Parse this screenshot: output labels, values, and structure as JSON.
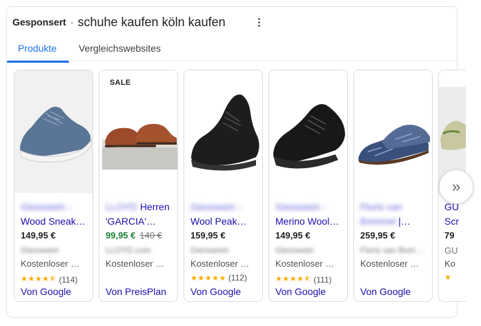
{
  "header": {
    "sponsored": "Gesponsert",
    "separator": "·",
    "query": "schuhe kaufen köln kaufen",
    "more_icon": "more-vert-icon"
  },
  "tabs": [
    {
      "label": "Produkte",
      "active": true
    },
    {
      "label": "Vergleichswebsites",
      "active": false
    }
  ],
  "products": [
    {
      "title": "Giesswein - Wood Sneak…",
      "title_line1": "Giesswein -",
      "title_line2": "Wood Sneak…",
      "price": "149,95 €",
      "merchant": "Giesswein",
      "shipping": "Kostenloser …",
      "rating": 4.5,
      "reviews": "(114)",
      "provider": "Von Google"
    },
    {
      "badge": "SALE",
      "title_line1_blur": "LLOYD",
      "title_line1": "Herren",
      "title_line2": "'GARCIA'…",
      "price": "99,95 €",
      "old_price": "140 €",
      "merchant": "LLOYD.com",
      "shipping": "Kostenloser …",
      "provider": "Von PreisPlan"
    },
    {
      "title_line1": "Giesswein -",
      "title_line2": "Wool Peak…",
      "price": "159,95 €",
      "merchant": "Giesswein",
      "shipping": "Kostenloser …",
      "rating": 5,
      "reviews": "(112)",
      "provider": "Von Google"
    },
    {
      "title_line1": "Giesswein -",
      "title_line2": "Merino Wool…",
      "price": "149,95 €",
      "merchant": "Giesswein",
      "shipping": "Kostenloser …",
      "rating": 4.5,
      "reviews": "(111)",
      "provider": "Von Google"
    },
    {
      "title_line1": "Floris van",
      "title_line2_blur": "Bommel",
      "title_line2": "|…",
      "price": "259,95 €",
      "merchant": "Floris van Bom…",
      "shipping": "Kostenloser …",
      "provider": "Von Google"
    }
  ],
  "partial_product": {
    "title_line1": "GU",
    "title_line2": "Scr",
    "price": "79",
    "merchant": "GU",
    "shipping": "Ko"
  },
  "next_button": {
    "icon": "chevron-double-right-icon",
    "label": "»"
  },
  "colors": {
    "link": "#1a0dab",
    "accent": "#1a73e8",
    "sale_price": "#188038",
    "star": "#f9ab00"
  }
}
